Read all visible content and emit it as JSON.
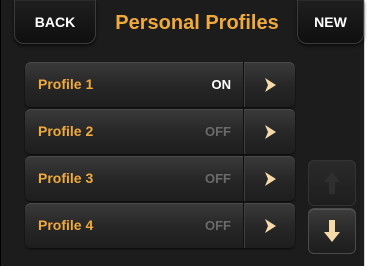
{
  "header": {
    "back_label": "BACK",
    "title": "Personal Profiles",
    "new_label": "NEW"
  },
  "profiles": [
    {
      "name": "Profile 1",
      "status": "ON"
    },
    {
      "name": "Profile 2",
      "status": "OFF"
    },
    {
      "name": "Profile 3",
      "status": "OFF"
    },
    {
      "name": "Profile 4",
      "status": "OFF"
    }
  ],
  "scroll": {
    "up_icon": "arrow-up-icon",
    "up_enabled": false,
    "down_icon": "arrow-down-icon",
    "down_enabled": true
  },
  "colors": {
    "accent": "#f0a93d",
    "background": "#1c1c1c",
    "status_on": "#ffffff",
    "status_off": "#6a6a6a",
    "arrow": "#f6d9a8"
  }
}
